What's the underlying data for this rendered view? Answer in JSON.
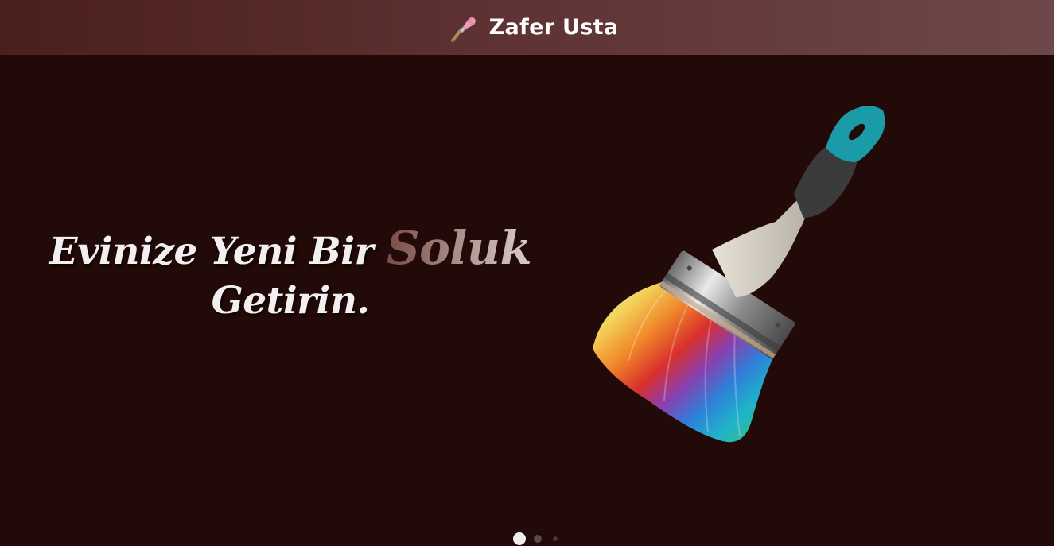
{
  "header": {
    "brand_name": "Zafer Usta",
    "brand_icon": "paintbrush-icon",
    "background_color": "#5e3132"
  },
  "hero": {
    "headline_part1": "Evinize Yeni Bir",
    "headline_accent": "Soluk",
    "headline_part2": "Getirin.",
    "image": "rainbow-paintbrush-image",
    "background_color": "#210a07"
  },
  "carousel": {
    "slide_count": 3,
    "active_index": 0
  }
}
